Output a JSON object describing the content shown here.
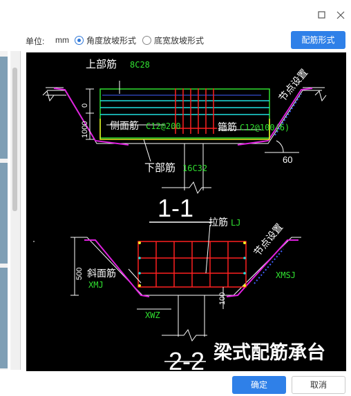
{
  "window": {
    "maximize_icon": "square-icon",
    "close_icon": "close-icon"
  },
  "options": {
    "unit_label": "单位:",
    "unit_value": "mm",
    "radio_angle": {
      "label": "角度放坡形式",
      "checked": true
    },
    "radio_width": {
      "label": "底宽放坡形式",
      "checked": false
    },
    "rebar_button": "配筋形式"
  },
  "drawing": {
    "section1": {
      "top_rebar_label": "上部筋",
      "top_rebar_value": "8C28",
      "side_rebar_label": "侧面筋",
      "side_rebar_value": "C12@200",
      "stirrup_label": "箍筋",
      "stirrup_value": "C12@100(6)",
      "bottom_rebar_label": "下部筋",
      "bottom_rebar_value": "16C32",
      "node_label": "节点设置",
      "dim_zero": "0",
      "dim_left": "1000",
      "angle": "60",
      "title": "1-1"
    },
    "section2": {
      "tie_label": "拉筋",
      "tie_value": "LJ",
      "slope_rebar_label": "斜面筋",
      "slope_rebar_value": "XMJ",
      "node_label": "节点设置",
      "xmsj": "XMSJ",
      "xwz": "XWZ",
      "dim_500": "500",
      "dim_100": "100",
      "title": "2-2"
    },
    "caption": "梁式配筋承台"
  },
  "footer": {
    "ok": "确定",
    "cancel": "取消"
  },
  "colors": {
    "accent": "#2f80e8",
    "cad_bg": "#000000",
    "rebar_red": "#ff2020",
    "magenta": "#e020e0",
    "cyan": "#20e0e0",
    "yellow": "#f0f020",
    "green_text": "#30e030"
  }
}
